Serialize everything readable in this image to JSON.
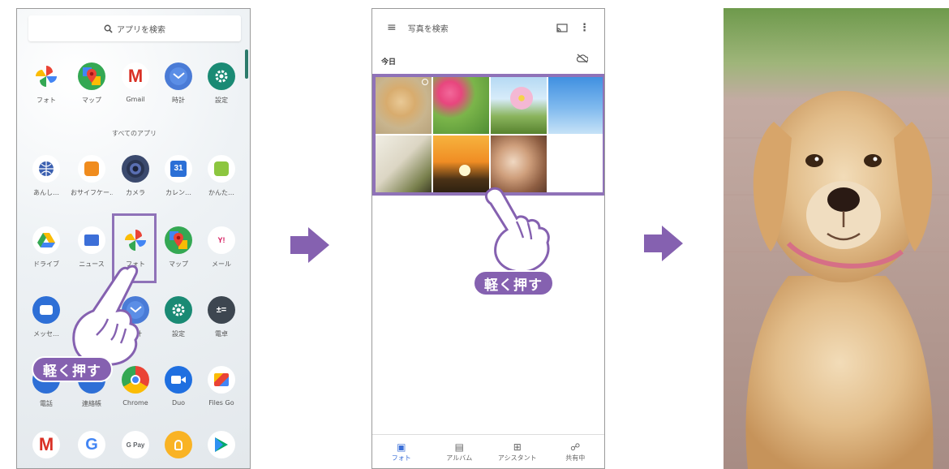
{
  "phone1": {
    "search_placeholder": "アプリを検索",
    "all_apps_label": "すべてのアプリ",
    "rows": [
      [
        {
          "label": "フォト",
          "icon": "photos-pinwheel-icon"
        },
        {
          "label": "マップ",
          "icon": "maps-pin-icon"
        },
        {
          "label": "Gmail",
          "icon": "gmail-m-icon"
        },
        {
          "label": "時計",
          "icon": "clock-icon"
        },
        {
          "label": "設定",
          "icon": "settings-gear-icon"
        }
      ],
      [
        {
          "label": "あんし…",
          "icon": "anshin-globe-icon"
        },
        {
          "label": "おサイフケー…",
          "icon": "osaifu-wallet-icon"
        },
        {
          "label": "カメラ",
          "icon": "camera-lens-icon"
        },
        {
          "label": "カレン…",
          "icon": "calendar-31-icon"
        },
        {
          "label": "かんた…",
          "icon": "kantan-icon"
        }
      ],
      [
        {
          "label": "ドライブ",
          "icon": "drive-triangle-icon"
        },
        {
          "label": "ニュース",
          "icon": "news-gs-icon"
        },
        {
          "label": "フォト",
          "icon": "photos-pinwheel-icon"
        },
        {
          "label": "マップ",
          "icon": "maps-pin-icon"
        },
        {
          "label": "メール",
          "icon": "yahoo-mail-icon"
        }
      ],
      [
        {
          "label": "メッセ…",
          "icon": "messages-bubble-icon"
        },
        {
          "label": "",
          "icon": "hidden-app-icon"
        },
        {
          "label": "時計",
          "icon": "clock-icon"
        },
        {
          "label": "設定",
          "icon": "settings-gear-icon"
        },
        {
          "label": "電卓",
          "icon": "calculator-icon"
        }
      ],
      [
        {
          "label": "電話",
          "icon": "phone-icon"
        },
        {
          "label": "連絡帳",
          "icon": "contacts-icon"
        },
        {
          "label": "Chrome",
          "icon": "chrome-icon"
        },
        {
          "label": "Duo",
          "icon": "duo-video-icon"
        },
        {
          "label": "Files Go",
          "icon": "files-go-icon"
        }
      ],
      [
        {
          "label": "",
          "icon": "gmail-m-icon"
        },
        {
          "label": "",
          "icon": "google-g-icon"
        },
        {
          "label": "",
          "icon": "gpay-icon"
        },
        {
          "label": "",
          "icon": "bulb-icon"
        },
        {
          "label": "",
          "icon": "play-store-icon"
        }
      ]
    ],
    "gpay_text": "G Pay",
    "calendar_text": "31",
    "press_label": "軽く押す"
  },
  "phone2": {
    "search_placeholder": "写真を検索",
    "section_today": "今日",
    "press_label": "軽く押す",
    "nav": [
      {
        "label": "フォト",
        "icon": "photo-tab-icon",
        "active": true
      },
      {
        "label": "アルバム",
        "icon": "album-tab-icon",
        "active": false
      },
      {
        "label": "アシスタント",
        "icon": "assistant-tab-icon",
        "active": false
      },
      {
        "label": "共有中",
        "icon": "sharing-tab-icon",
        "active": false
      }
    ]
  },
  "colors": {
    "highlight_purple": "#8f72b8",
    "label_purple": "#8561b0",
    "arrow_purple": "#8561b0",
    "active_blue": "#3b6fd8"
  }
}
